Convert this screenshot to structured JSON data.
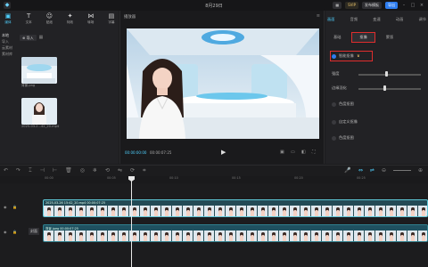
{
  "titlebar": {
    "title": "8月29日",
    "vip_label": "SVIP",
    "share_label": "发布模板",
    "export_label": "导出"
  },
  "left": {
    "tools": [
      {
        "label": "媒体",
        "icon": "media-icon",
        "active": true
      },
      {
        "label": "文本",
        "icon": "text-icon"
      },
      {
        "label": "贴纸",
        "icon": "sticker-icon"
      },
      {
        "label": "特效",
        "icon": "effects-icon"
      },
      {
        "label": "转场",
        "icon": "transition-icon"
      },
      {
        "label": "字幕",
        "icon": "caption-icon"
      }
    ],
    "subnav": [
      "本地",
      "导入",
      "云素材",
      "素材库"
    ],
    "import_label": "导入",
    "media": [
      {
        "caption": "背景.png",
        "badge": "已添加"
      },
      {
        "caption": "2025-03-2...42_20.mp4",
        "badge": "已添加"
      }
    ]
  },
  "player": {
    "header": "播放器",
    "time_current": "00:00:00:00",
    "time_total": "00:00:07:25"
  },
  "right": {
    "tabs": [
      "画面",
      "音频",
      "变速",
      "动画",
      "调节"
    ],
    "subtabs": [
      "基础",
      "抠像",
      "蒙版"
    ],
    "active_subtab": "抠像",
    "rows": [
      {
        "label": "智能抠像",
        "checked": true
      },
      {
        "label": "强度"
      },
      {
        "label": "边缘羽化"
      },
      {
        "label": "色度抠图",
        "checked": false
      },
      {
        "label": "自定义抠像",
        "checked": false
      },
      {
        "label": "色度抠图",
        "checked": false
      }
    ]
  },
  "timeline": {
    "ruler_labels": [
      "00:00",
      "00:05",
      "00:10",
      "00:15",
      "00:20",
      "00:25"
    ],
    "trackA_label": "2025-03-26 15:42_20.mp4   00:00:07:25",
    "trackB_label": "背景.jpeg   00:00:07:25",
    "cover_label": "封面"
  },
  "colors": {
    "accent": "#4fd1ff",
    "export": "#2d7df0",
    "highlight": "#e02d2d"
  }
}
